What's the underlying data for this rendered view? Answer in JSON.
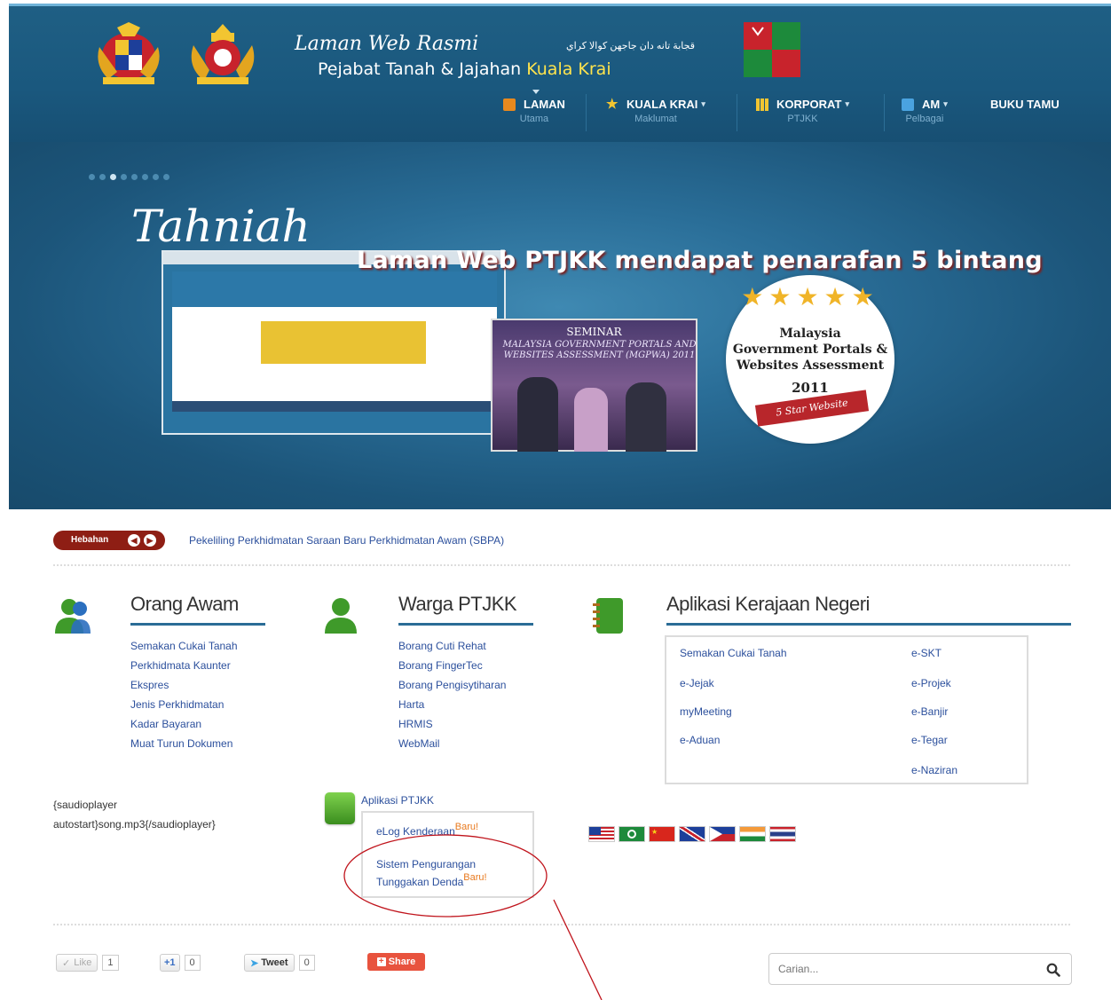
{
  "header": {
    "title_script": "Laman Web Rasmi",
    "title_jawi": "قجابة تانه دان جاجهن كوالا كراي",
    "title_main_prefix": "Pejabat Tanah & Jajahan ",
    "title_main_highlight": "Kuala Krai",
    "nav": [
      {
        "label": "LAMAN",
        "sub": "Utama"
      },
      {
        "label": "KUALA KRAI",
        "sub": "Maklumat"
      },
      {
        "label": "KORPORAT",
        "sub": "PTJKK"
      },
      {
        "label": "AM",
        "sub": "Pelbagai"
      },
      {
        "label": "BUKU TAMU",
        "sub": ""
      }
    ]
  },
  "banner": {
    "tahniah": "Tahniah",
    "headline": "Laman Web PTJKK mendapat penarafan 5 bintang",
    "photo_caption": "SEMINAR",
    "photo_caption2": "MALAYSIA GOVERNMENT PORTALS AND WEBSITES ASSESSMENT (MGPWA) 2011",
    "badge": {
      "line1": "Malaysia",
      "line2": "Government Portals &",
      "line3": "Websites Assessment",
      "year": "2011",
      "ribbon": "5 Star Website"
    },
    "active_slide": 3,
    "slide_count": 8
  },
  "hebahan": {
    "label": "Hebahan",
    "ticker": "Pekeliling Perkhidmatan Saraan Baru Perkhidmatan Awam (SBPA)"
  },
  "orang_awam": {
    "title": "Orang Awam",
    "links": [
      "Semakan Cukai Tanah",
      "Perkhidmata Kaunter",
      "Ekspres",
      "Jenis Perkhidmatan",
      "Kadar Bayaran",
      "Muat Turun Dokumen"
    ]
  },
  "warga": {
    "title": "Warga PTJKK",
    "links": [
      "Borang Cuti Rehat",
      "Borang FingerTec",
      "Borang Pengisytiharan",
      "Harta",
      "HRMIS",
      "WebMail"
    ]
  },
  "aplikasi_negeri": {
    "title": "Aplikasi Kerajaan Negeri",
    "col1": [
      "Semakan Cukai Tanah",
      "e-Jejak",
      "myMeeting",
      "e-Aduan"
    ],
    "col2": [
      "e-SKT",
      "e-Projek",
      "e-Banjir",
      "e-Tegar",
      "e-Naziran"
    ]
  },
  "audioplayer": {
    "line1": "{saudioplayer",
    "line2": "autostart}song.mp3{/saudioplayer}"
  },
  "aplikasi_ptjkk": {
    "title": "Aplikasi PTJKK",
    "item1": "eLog Kenderaan",
    "item2_line1": "Sistem Pengurangan",
    "item2_line2": "Tunggakan Denda",
    "baru": "Baru!"
  },
  "languages": [
    "Bahasa Melayu",
    "Arabic",
    "Chinese",
    "English",
    "Filipino",
    "Hindi",
    "Thai"
  ],
  "social": {
    "like": "Like",
    "like_count": "1",
    "gplus": "+1",
    "gplus_count": "0",
    "tweet": "Tweet",
    "tweet_count": "0",
    "share": "Share"
  },
  "search": {
    "placeholder": "Carian..."
  },
  "colors": {
    "header_bg": "#1f5f84",
    "link": "#2b4f9c",
    "hebahan": "#8e1e14",
    "accent_line": "#2b6c96",
    "annotation": "#c0141c"
  }
}
